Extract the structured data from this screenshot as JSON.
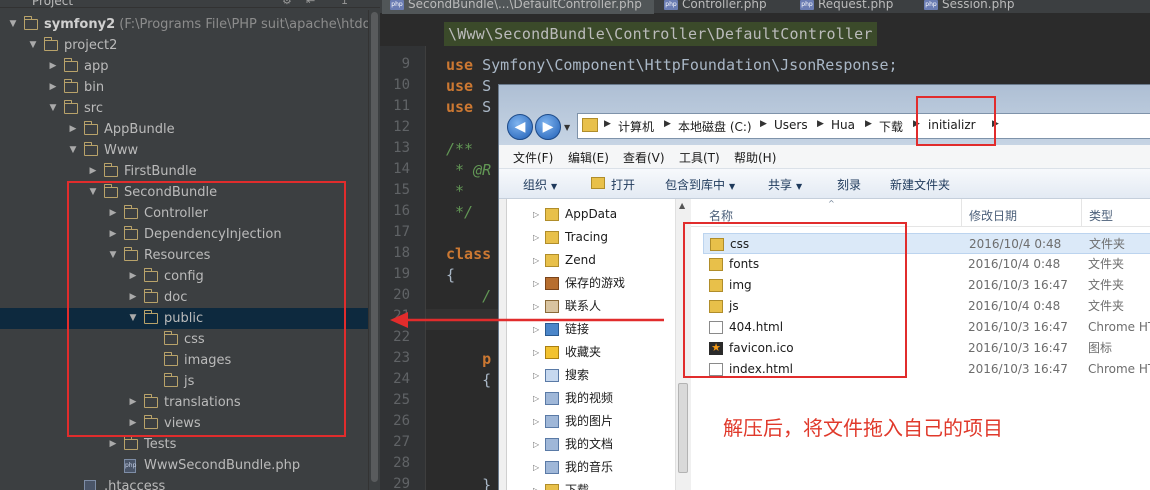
{
  "project_panel": {
    "header_title": "Project",
    "rows": [
      {
        "label": "symfony2",
        "path": " (F:\\Programs File\\PHP suit\\apache\\htdocs\\sym",
        "arrow": "▼",
        "icon": "folder",
        "depth": 0,
        "bold": true
      },
      {
        "label": "project2",
        "arrow": "▼",
        "icon": "folder",
        "depth": 1
      },
      {
        "label": "app",
        "arrow": "▶",
        "icon": "folder",
        "depth": 2
      },
      {
        "label": "bin",
        "arrow": "▶",
        "icon": "folder",
        "depth": 2
      },
      {
        "label": "src",
        "arrow": "▼",
        "icon": "folder",
        "depth": 2
      },
      {
        "label": "AppBundle",
        "arrow": "▶",
        "icon": "folder",
        "depth": 3
      },
      {
        "label": "Www",
        "arrow": "▼",
        "icon": "folder",
        "depth": 3
      },
      {
        "label": "FirstBundle",
        "arrow": "▶",
        "icon": "folder",
        "depth": 4
      },
      {
        "label": "SecondBundle",
        "arrow": "▼",
        "icon": "folder",
        "depth": 4
      },
      {
        "label": "Controller",
        "arrow": "▶",
        "icon": "folder",
        "depth": 5
      },
      {
        "label": "DependencyInjection",
        "arrow": "▶",
        "icon": "folder",
        "depth": 5
      },
      {
        "label": "Resources",
        "arrow": "▼",
        "icon": "folder",
        "depth": 5
      },
      {
        "label": "config",
        "arrow": "▶",
        "icon": "folder",
        "depth": 6
      },
      {
        "label": "doc",
        "arrow": "▶",
        "icon": "folder",
        "depth": 6
      },
      {
        "label": "public",
        "arrow": "▼",
        "icon": "folder",
        "depth": 6,
        "selected": true
      },
      {
        "label": "css",
        "arrow": "",
        "icon": "folder",
        "depth": 7
      },
      {
        "label": "images",
        "arrow": "",
        "icon": "folder",
        "depth": 7
      },
      {
        "label": "js",
        "arrow": "",
        "icon": "folder",
        "depth": 7
      },
      {
        "label": "translations",
        "arrow": "▶",
        "icon": "folder",
        "depth": 6
      },
      {
        "label": "views",
        "arrow": "▶",
        "icon": "folder",
        "depth": 6
      },
      {
        "label": "Tests",
        "arrow": "▶",
        "icon": "folder",
        "depth": 5
      },
      {
        "label": "WwwSecondBundle.php",
        "arrow": "",
        "icon": "php",
        "depth": 5
      },
      {
        "label": ".htaccess",
        "arrow": "",
        "icon": "file",
        "depth": 3
      }
    ]
  },
  "editor": {
    "tabs": [
      {
        "label": "SecondBundle\\...\\DefaultController.php",
        "active": true
      },
      {
        "label": "Controller.php",
        "active": false
      },
      {
        "label": "Request.php",
        "active": false
      },
      {
        "label": "Session.php",
        "active": false
      }
    ],
    "php_badge": "php",
    "breadcrumb": "\\Www\\SecondBundle\\Controller\\DefaultController",
    "lines": [
      {
        "n": "9",
        "parts": [
          {
            "t": "use ",
            "c": "kw"
          },
          {
            "t": "Symfony\\Component\\HttpFoundation\\JsonResponse;",
            "c": "ns"
          }
        ]
      },
      {
        "n": "10",
        "parts": [
          {
            "t": "use ",
            "c": "kw"
          },
          {
            "t": "S",
            "c": "ns"
          }
        ]
      },
      {
        "n": "11",
        "parts": [
          {
            "t": "use ",
            "c": "kw"
          },
          {
            "t": "S",
            "c": "ns"
          }
        ]
      },
      {
        "n": "12",
        "parts": []
      },
      {
        "n": "13",
        "parts": [
          {
            "t": "/**",
            "c": "cm"
          }
        ]
      },
      {
        "n": "14",
        "parts": [
          {
            "t": " * @R",
            "c": "cm"
          }
        ]
      },
      {
        "n": "15",
        "parts": [
          {
            "t": " *",
            "c": "cm"
          }
        ]
      },
      {
        "n": "16",
        "parts": [
          {
            "t": " */",
            "c": "cm"
          }
        ]
      },
      {
        "n": "17",
        "parts": []
      },
      {
        "n": "18",
        "parts": [
          {
            "t": "class",
            "c": "kw"
          }
        ]
      },
      {
        "n": "19",
        "parts": [
          {
            "t": "{",
            "c": "ns"
          }
        ]
      },
      {
        "n": "20",
        "parts": [
          {
            "t": "    /",
            "c": "cm"
          }
        ]
      },
      {
        "n": "21",
        "parts": []
      },
      {
        "n": "22",
        "parts": []
      },
      {
        "n": "23",
        "parts": [
          {
            "t": "    p",
            "c": "kw"
          }
        ]
      },
      {
        "n": "24",
        "parts": [
          {
            "t": "    {",
            "c": "ns"
          }
        ]
      },
      {
        "n": "25",
        "parts": []
      },
      {
        "n": "26",
        "parts": []
      },
      {
        "n": "27",
        "parts": []
      },
      {
        "n": "28",
        "parts": []
      },
      {
        "n": "29",
        "parts": [
          {
            "t": "    }",
            "c": "ns"
          }
        ]
      }
    ]
  },
  "explorer": {
    "back_glyph": "◀",
    "forward_glyph": "▶",
    "address": [
      "计算机",
      "本地磁盘 (C:)",
      "Users",
      "Hua",
      "下载",
      "initializr"
    ],
    "menu": [
      "文件(F)",
      "编辑(E)",
      "查看(V)",
      "工具(T)",
      "帮助(H)"
    ],
    "toolbar": {
      "organize": "组织",
      "open": "打开",
      "include_library": "包含到库中",
      "share": "共享",
      "burn": "刻录",
      "new_folder": "新建文件夹"
    },
    "nav_items": [
      {
        "label": "AppData",
        "icon": "folder"
      },
      {
        "label": "Tracing",
        "icon": "folder"
      },
      {
        "label": "Zend",
        "icon": "folder"
      },
      {
        "label": "保存的游戏",
        "icon": "game"
      },
      {
        "label": "联系人",
        "icon": "contact"
      },
      {
        "label": "链接",
        "icon": "link"
      },
      {
        "label": "收藏夹",
        "icon": "fav"
      },
      {
        "label": "搜索",
        "icon": "srch"
      },
      {
        "label": "我的视频",
        "icon": "special"
      },
      {
        "label": "我的图片",
        "icon": "special"
      },
      {
        "label": "我的文档",
        "icon": "special"
      },
      {
        "label": "我的音乐",
        "icon": "special"
      },
      {
        "label": "下载",
        "icon": "folder"
      }
    ],
    "columns": {
      "name": "名称",
      "modified": "修改日期",
      "type": "类型"
    },
    "files": [
      {
        "name": "css",
        "date": "2016/10/4 0:48",
        "type": "文件夹",
        "icon": "folder",
        "selected": true
      },
      {
        "name": "fonts",
        "date": "2016/10/4 0:48",
        "type": "文件夹",
        "icon": "folder"
      },
      {
        "name": "img",
        "date": "2016/10/3 16:47",
        "type": "文件夹",
        "icon": "folder"
      },
      {
        "name": "js",
        "date": "2016/10/4 0:48",
        "type": "文件夹",
        "icon": "folder"
      },
      {
        "name": "404.html",
        "date": "2016/10/3 16:47",
        "type": "Chrome HT",
        "icon": "file"
      },
      {
        "name": "favicon.ico",
        "date": "2016/10/3 16:47",
        "type": "图标",
        "icon": "star"
      },
      {
        "name": "index.html",
        "date": "2016/10/3 16:47",
        "type": "Chrome HT",
        "icon": "file"
      }
    ],
    "note": "解压后，将文件拖入自己的项目"
  },
  "colors": {
    "annotation_red": "#e12c2c",
    "note_red": "#e0392b",
    "ide_keyword": "#cc7832",
    "ide_comment": "#629755"
  }
}
